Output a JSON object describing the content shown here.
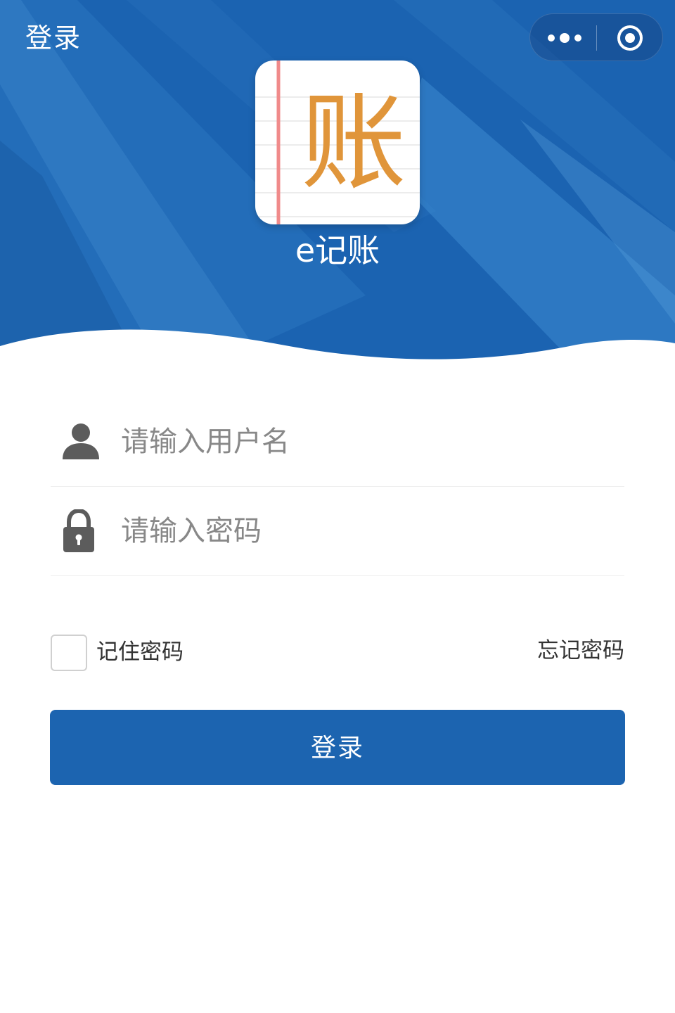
{
  "nav": {
    "title": "登录",
    "capsule_icons": [
      "more-icon",
      "target-icon"
    ]
  },
  "brand": {
    "logo_char": "账",
    "app_name": "e记账",
    "logo_char_color": "#e0953a"
  },
  "form": {
    "username_placeholder": "请输入用户名",
    "password_placeholder": "请输入密码",
    "remember_label": "记住密码",
    "forgot_label": "忘记密码",
    "login_label": "登录"
  },
  "colors": {
    "primary": "#1c64b0",
    "header_light": "#3a86cc",
    "icon_gray": "#5c5c5c",
    "text": "#333333",
    "placeholder": "#888888"
  }
}
